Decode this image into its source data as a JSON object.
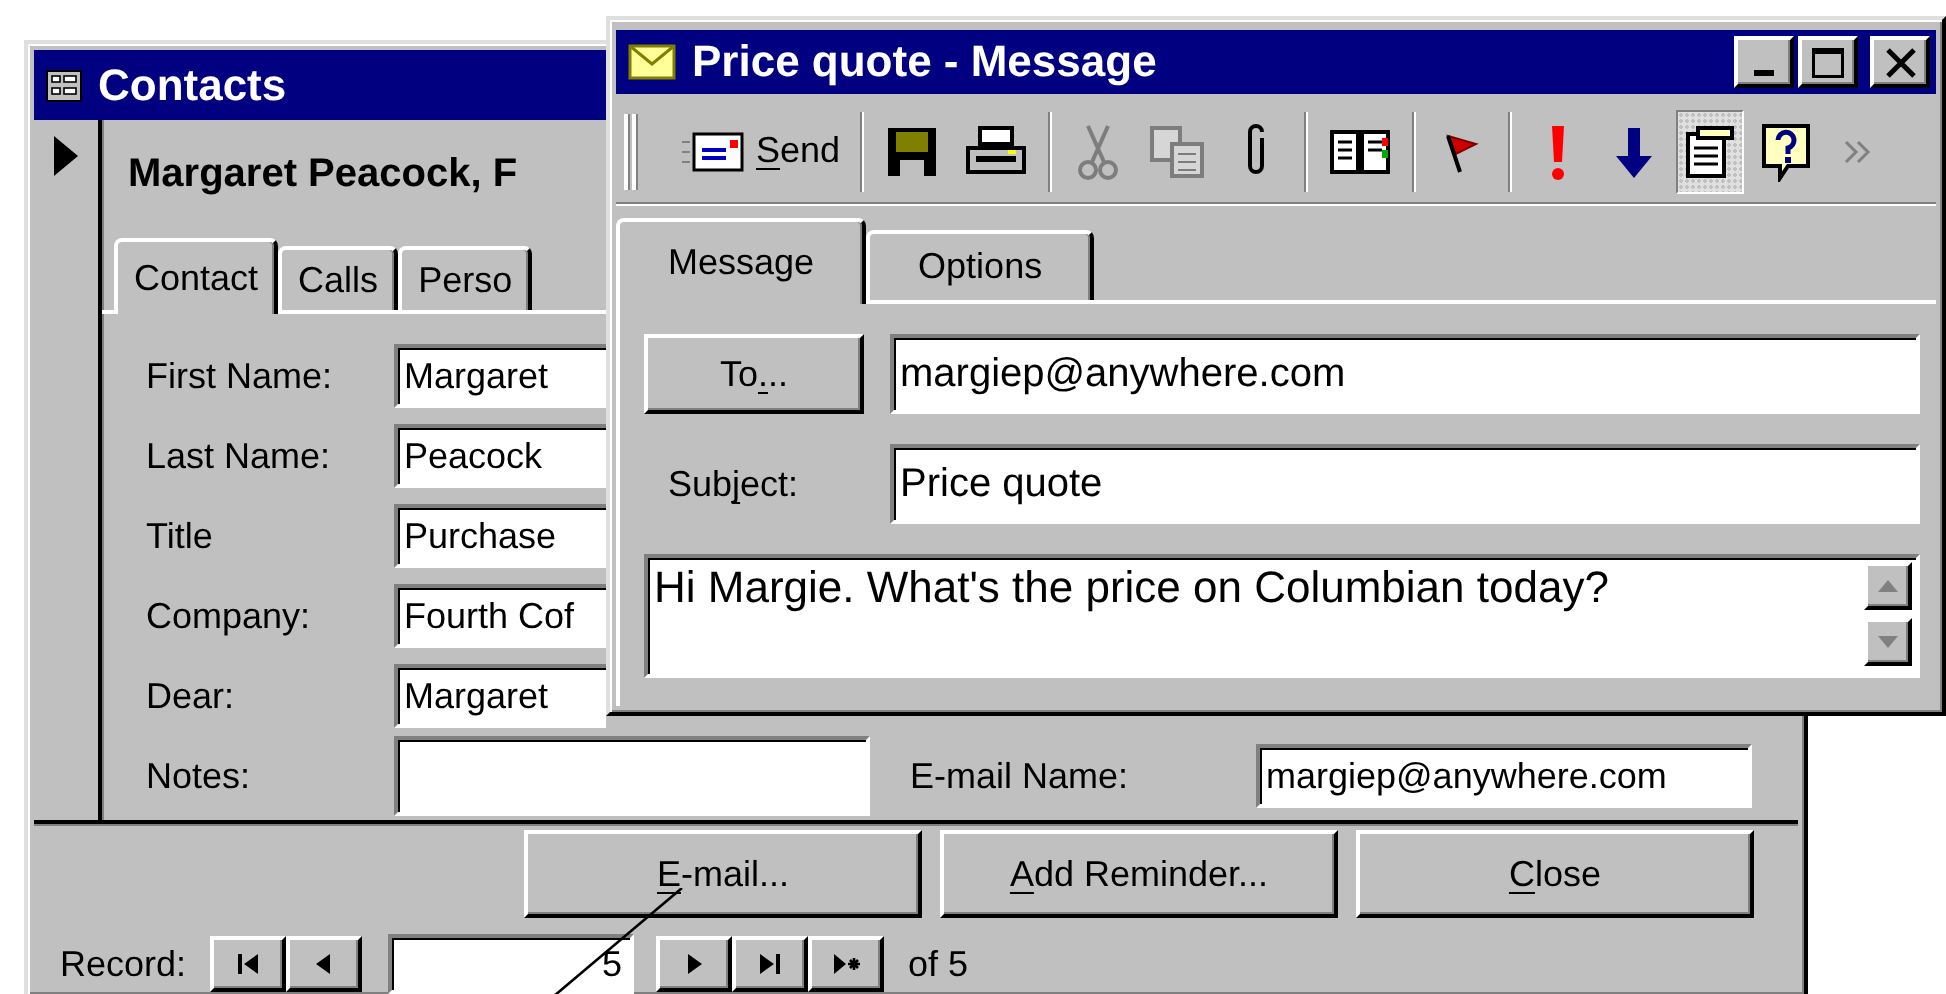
{
  "contacts_window": {
    "title": "Contacts",
    "record_title": "Margaret Peacock, F",
    "tabs": [
      {
        "label": "Contact",
        "selected": true
      },
      {
        "label": "Calls",
        "selected": false
      },
      {
        "label": "Perso",
        "selected": false
      }
    ],
    "fields": [
      {
        "label": "First Name:",
        "value": "Margaret"
      },
      {
        "label": "Last Name:",
        "value": "Peacock"
      },
      {
        "label": "Title",
        "value": "Purchase"
      },
      {
        "label": "Company:",
        "value": "Fourth Cof"
      },
      {
        "label": "Dear:",
        "value": "Margaret"
      },
      {
        "label": "Notes:"
      }
    ],
    "email_name": {
      "label": "E-mail Name:",
      "value": "margiep@anywhere.com"
    },
    "buttons": [
      {
        "label_parts": [
          {
            "text": "E",
            "underlined": true
          },
          {
            "text": "-mail...",
            "underlined": false
          }
        ]
      },
      {
        "label_parts": [
          {
            "text": "A",
            "underlined": true
          },
          {
            "text": "dd Reminder...",
            "underlined": false
          }
        ]
      },
      {
        "label_parts": [
          {
            "text": "C",
            "underlined": true
          },
          {
            "text": "lose",
            "underlined": false
          }
        ]
      }
    ],
    "navigation": {
      "label": "Record:",
      "current": "5",
      "total": "of 5"
    }
  },
  "message_window": {
    "title": "Price quote - Message",
    "toolbar_groups": [
      [
        {
          "kind": "send",
          "label_parts": [
            {
              "text": "S",
              "underlined": true
            },
            {
              "text": "end",
              "underlined": false
            }
          ],
          "disabled": false,
          "pressed": false
        }
      ],
      [
        {
          "kind": "save",
          "disabled": false,
          "pressed": false
        },
        {
          "kind": "print",
          "disabled": false,
          "pressed": false
        }
      ],
      [
        {
          "kind": "cut",
          "disabled": true,
          "pressed": false
        },
        {
          "kind": "copy",
          "disabled": true,
          "pressed": false
        },
        {
          "kind": "attach",
          "disabled": false,
          "pressed": false
        }
      ],
      [
        {
          "kind": "address_book",
          "disabled": false,
          "pressed": false
        }
      ],
      [
        {
          "kind": "flag",
          "disabled": false,
          "pressed": false
        }
      ],
      [
        {
          "kind": "high_importance",
          "disabled": false,
          "pressed": false
        },
        {
          "kind": "low_importance",
          "disabled": false,
          "pressed": false
        },
        {
          "kind": "options",
          "disabled": false,
          "pressed": true
        },
        {
          "kind": "help",
          "disabled": false,
          "pressed": false
        }
      ]
    ],
    "tabs": [
      {
        "label": "Message",
        "selected": true
      },
      {
        "label": "Options",
        "selected": false
      }
    ],
    "to_button": {
      "label_parts": [
        {
          "text": "To",
          "underlined": false
        },
        {
          "text": ".",
          "underlined": true
        },
        {
          "text": "..",
          "underlined": false
        }
      ]
    },
    "to": "margiep@anywhere.com",
    "subject_label": {
      "label_parts": [
        {
          "text": "Sub",
          "underlined": false
        },
        {
          "text": "j",
          "underlined": true
        },
        {
          "text": "ect:",
          "underlined": false
        }
      ]
    },
    "subject": "Price quote",
    "body": "Hi Margie. What's the price on Columbian today?"
  }
}
